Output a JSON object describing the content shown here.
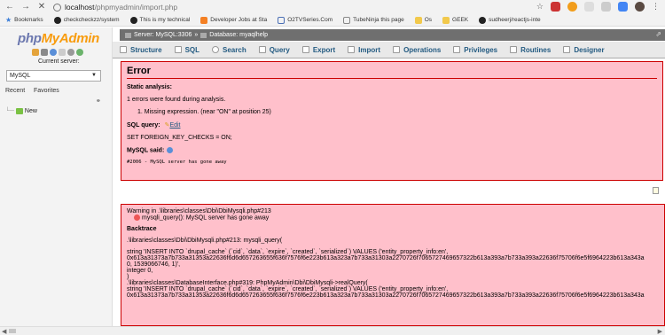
{
  "browser": {
    "url_host": "localhost",
    "url_path": "/phpmyadmin/import.php",
    "bookmarks": [
      {
        "label": "Bookmarks",
        "icon": "star-icon"
      },
      {
        "label": "checkcheckzz/system",
        "icon": "github-icon"
      },
      {
        "label": "This is my technical",
        "icon": "github-icon"
      },
      {
        "label": "Developer Jobs at Sta",
        "icon": "stackoverflow-icon"
      },
      {
        "label": "O2TVSeries.Com",
        "icon": "page-icon"
      },
      {
        "label": "TubeNinja this page",
        "icon": "page-icon"
      },
      {
        "label": "Os",
        "icon": "folder-icon"
      },
      {
        "label": "GEEK",
        "icon": "folder-icon"
      },
      {
        "label": "sudheerj/reactjs-inte",
        "icon": "github-icon"
      }
    ]
  },
  "sidebar": {
    "logo_php": "php",
    "logo_myadmin": "MyAdmin",
    "current_server_label": "Current server:",
    "server_value": "MySQL",
    "recent": "Recent",
    "favorites": "Favorites",
    "new_item": "New"
  },
  "breadcrumb": {
    "server": "Server: MySQL:3306",
    "sep": "»",
    "database": "Database: myaqlhelp"
  },
  "tabs": [
    {
      "label": "Structure"
    },
    {
      "label": "SQL"
    },
    {
      "label": "Search"
    },
    {
      "label": "Query"
    },
    {
      "label": "Export"
    },
    {
      "label": "Import"
    },
    {
      "label": "Operations"
    },
    {
      "label": "Privileges"
    },
    {
      "label": "Routines"
    },
    {
      "label": "Designer"
    }
  ],
  "error": {
    "title": "Error",
    "static_analysis": "Static analysis:",
    "errors_found": "1 errors were found during analysis.",
    "error_item": "1. Missing expression. (near \"ON\" at position 25)",
    "sql_query_label": "SQL query:",
    "edit_label": "Edit",
    "sql_query": "SET FOREIGN_KEY_CHECKS = ON;",
    "mysql_said": "MySQL said:",
    "mysql_error": "#2006 - MySQL server has gone away"
  },
  "warning": {
    "line1": "Warning in .\\libraries\\classes\\Dbi\\DbiMysqli.php#213",
    "line2": "mysqli_query(): MySQL server has gone away",
    "backtrace": "Backtrace",
    "bt1": ".\\libraries\\classes\\Dbi\\DbiMysqli.php#213: mysqli_query(",
    "bt2": "string 'INSERT INTO `drupal_cache` (`cid`, `data`, `expire`, `created`, `serialized`) VALUES ('entity_property_info:en',",
    "bt3": "0x613a31373a7b733a31353a22636f6d6d657263655f636f7576f6e223b613a323a7b733a31303a2270726f7065727469657322b613a393a7b733a393a22636f75706f6e5f6964223b613a343a",
    "bt4": "0, 1539066746, 1)',",
    "bt5": "integer 0,",
    "bt6": ")",
    "bt7": ".\\libraries\\classes\\DatabaseInterface.php#319: PhpMyAdmin\\Dbi\\DbiMysqli->realQuery(",
    "bt8": "string 'INSERT INTO `drupal_cache` (`cid`, `data`, `expire`, `created`, `serialized`) VALUES ('entity_property_info:en',",
    "bt9": "0x613a31373a7b733a31353a22636f6d6d657263655f636f7576f6e223b613a323a7b733a31303a2270726f7065727469657322b613a393a7b733a393a22636f75706f6e5f6964223b613a343a"
  }
}
